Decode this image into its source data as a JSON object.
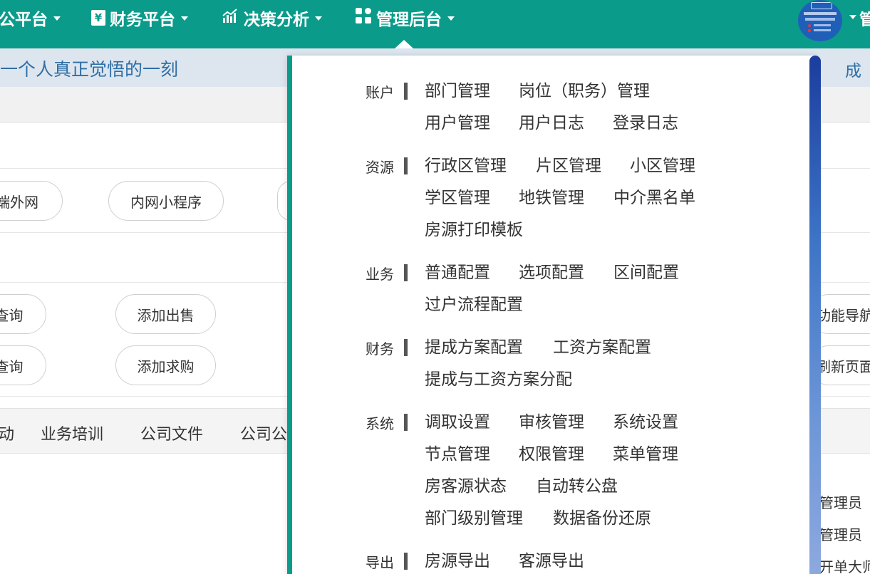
{
  "nav": {
    "items": [
      {
        "label": "公平台"
      },
      {
        "label": "财务平台",
        "icon": "yen-icon"
      },
      {
        "label": "决策分析",
        "icon": "chart-icon"
      },
      {
        "label": "管理后台",
        "icon": "grid-icon"
      }
    ],
    "user_name": "管"
  },
  "banner": {
    "quote": "一个人真正觉悟的一刻",
    "right_text": "成"
  },
  "background": {
    "pills_row1": [
      "端外网",
      "内网小程序"
    ],
    "pills_row2": [
      "查询",
      "添加出售"
    ],
    "pills_row3": [
      "查询",
      "添加求购"
    ],
    "side_buttons": [
      "功能导航",
      "刷新页面"
    ],
    "tabs": [
      "动",
      "业务培训",
      "公司文件",
      "公司公"
    ],
    "right_list": [
      "管理员",
      "管理员",
      "开单大师"
    ]
  },
  "menu": {
    "groups": [
      {
        "label": "账户",
        "rows": [
          [
            "部门管理",
            "岗位（职务）管理"
          ],
          [
            "用户管理",
            "用户日志",
            "登录日志"
          ]
        ]
      },
      {
        "label": "资源",
        "rows": [
          [
            "行政区管理",
            "片区管理",
            "小区管理"
          ],
          [
            "学区管理",
            "地铁管理",
            "中介黑名单"
          ],
          [
            "房源打印模板"
          ]
        ]
      },
      {
        "label": "业务",
        "rows": [
          [
            "普通配置",
            "选项配置",
            "区间配置"
          ],
          [
            "过户流程配置"
          ]
        ]
      },
      {
        "label": "财务",
        "rows": [
          [
            "提成方案配置",
            "工资方案配置"
          ],
          [
            "提成与工资方案分配"
          ]
        ]
      },
      {
        "label": "系统",
        "rows": [
          [
            "调取设置",
            "审核管理",
            "系统设置"
          ],
          [
            "节点管理",
            "权限管理",
            "菜单管理"
          ],
          [
            "房客源状态",
            "自动转公盘"
          ],
          [
            "部门级别管理",
            "数据备份还原"
          ]
        ]
      },
      {
        "label": "导出",
        "rows": [
          [
            "房源导出",
            "客源导出"
          ]
        ]
      }
    ]
  }
}
